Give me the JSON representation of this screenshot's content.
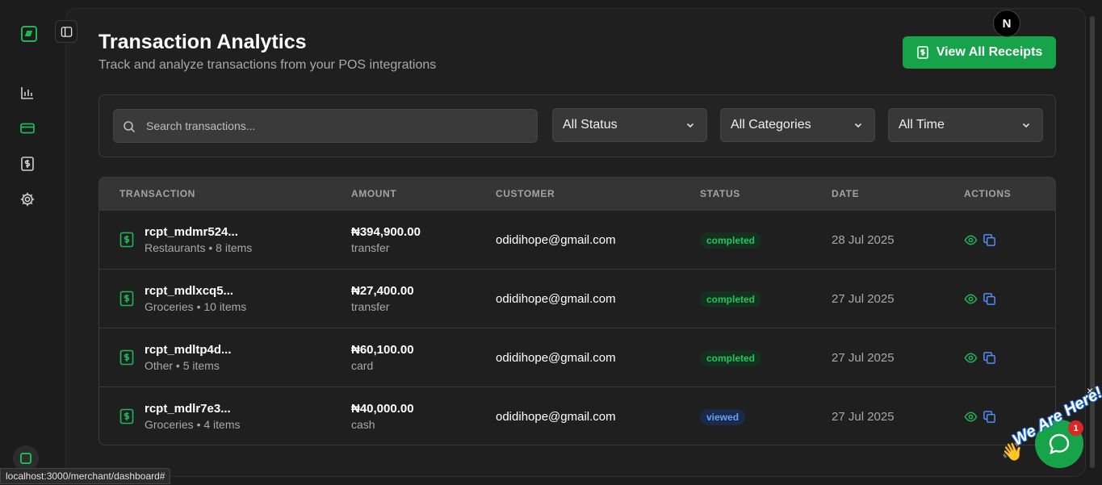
{
  "header": {
    "title": "Transaction Analytics",
    "subtitle": "Track and analyze transactions from your POS integrations",
    "view_receipts_label": "View All Receipts",
    "user_initial": "N"
  },
  "filters": {
    "search_placeholder": "Search transactions...",
    "status": "All Status",
    "category": "All Categories",
    "time": "All Time"
  },
  "table": {
    "columns": [
      "TRANSACTION",
      "AMOUNT",
      "CUSTOMER",
      "STATUS",
      "DATE",
      "ACTIONS"
    ],
    "rows": [
      {
        "id": "rcpt_mdmr524...",
        "sub": "Restaurants • 8 items",
        "amount": "₦394,900.00",
        "method": "transfer",
        "customer": "odidihope@gmail.com",
        "status": "completed",
        "date": "28 Jul 2025"
      },
      {
        "id": "rcpt_mdlxcq5...",
        "sub": "Groceries • 10 items",
        "amount": "₦27,400.00",
        "method": "transfer",
        "customer": "odidihope@gmail.com",
        "status": "completed",
        "date": "27 Jul 2025"
      },
      {
        "id": "rcpt_mdltp4d...",
        "sub": "Other • 5 items",
        "amount": "₦60,100.00",
        "method": "card",
        "customer": "odidihope@gmail.com",
        "status": "completed",
        "date": "27 Jul 2025"
      },
      {
        "id": "rcpt_mdlr7e3...",
        "sub": "Groceries • 4 items",
        "amount": "₦40,000.00",
        "method": "cash",
        "customer": "odidihope@gmail.com",
        "status": "viewed",
        "date": "27 Jul 2025"
      }
    ]
  },
  "chat": {
    "tagline": "We Are Here!",
    "unread_count": "1",
    "close": "×"
  },
  "status_bar": {
    "url": "localhost:3000/merchant/dashboard#"
  },
  "colors": {
    "brand_green": "#16a34a",
    "status_completed": "#22c55e",
    "status_viewed": "#60a5fa"
  }
}
